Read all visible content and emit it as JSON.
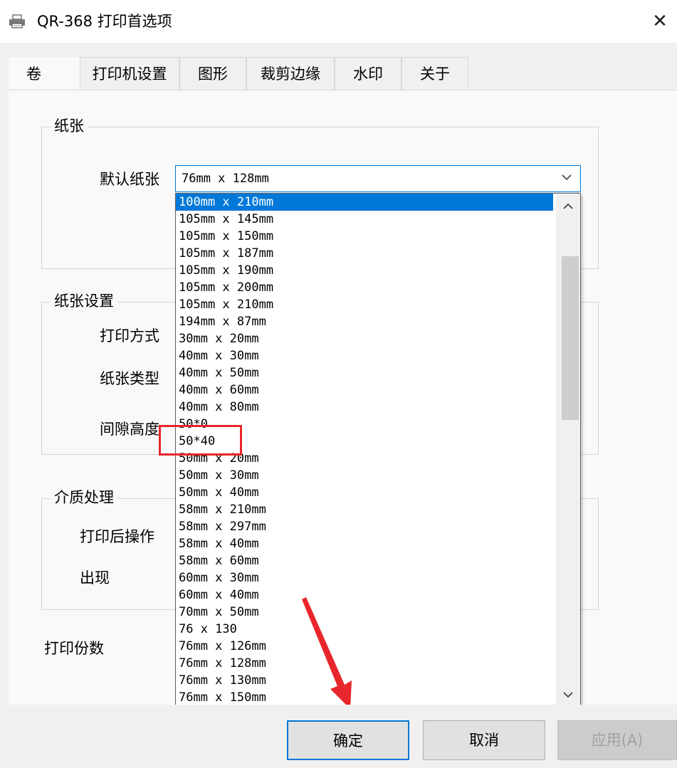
{
  "window": {
    "title": "QR-368 打印首选项",
    "close_glyph": "✕"
  },
  "tabs": [
    {
      "label": "卷",
      "active": true
    },
    {
      "label": "打印机设置",
      "active": false
    },
    {
      "label": "图形",
      "active": false
    },
    {
      "label": "裁剪边缘",
      "active": false
    },
    {
      "label": "水印",
      "active": false
    },
    {
      "label": "关于",
      "active": false
    }
  ],
  "paper_group": {
    "title": "纸张",
    "default_paper_label": "默认纸张",
    "default_paper_value": "76mm x 128mm"
  },
  "paper_settings_group": {
    "title": "纸张设置",
    "print_mode_label": "打印方式",
    "paper_type_label": "纸张类型",
    "gap_height_label": "间隙高度"
  },
  "media_group": {
    "title": "介质处理",
    "after_print_label": "打印后操作",
    "appear_label": "出现"
  },
  "copies_label": "打印份数",
  "dropdown": {
    "options": [
      "100mm x 210mm",
      "105mm x 145mm",
      "105mm x 150mm",
      "105mm x 187mm",
      "105mm x 190mm",
      "105mm x 200mm",
      "105mm x 210mm",
      "194mm x 87mm",
      "30mm x 20mm",
      "40mm x 30mm",
      "40mm x 50mm",
      "40mm x 60mm",
      "40mm x 80mm",
      "50*0",
      "50*40",
      "50mm x 20mm",
      "50mm x 30mm",
      "50mm x 40mm",
      "58mm x 210mm",
      "58mm x 297mm",
      "58mm x 40mm",
      "58mm x 60mm",
      "60mm x 30mm",
      "60mm x 40mm",
      "70mm x 50mm",
      "76 x 130",
      "76mm x 126mm",
      "76mm x 128mm",
      "76mm x 130mm",
      "76mm x 150mm"
    ],
    "highlighted_index": 0,
    "annotated_option": "50*40"
  },
  "buttons": {
    "ok": "确定",
    "cancel": "取消",
    "apply": "应用(A)"
  },
  "colors": {
    "accent": "#0078d7",
    "annotation_red": "#e8262b"
  },
  "icons": {
    "app": "printer-icon",
    "close": "close-icon",
    "combo_arrow": "chevron-down-icon",
    "scroll_up": "chevron-up-icon",
    "scroll_down": "chevron-down-icon",
    "annotation": "red-arrow-icon"
  }
}
